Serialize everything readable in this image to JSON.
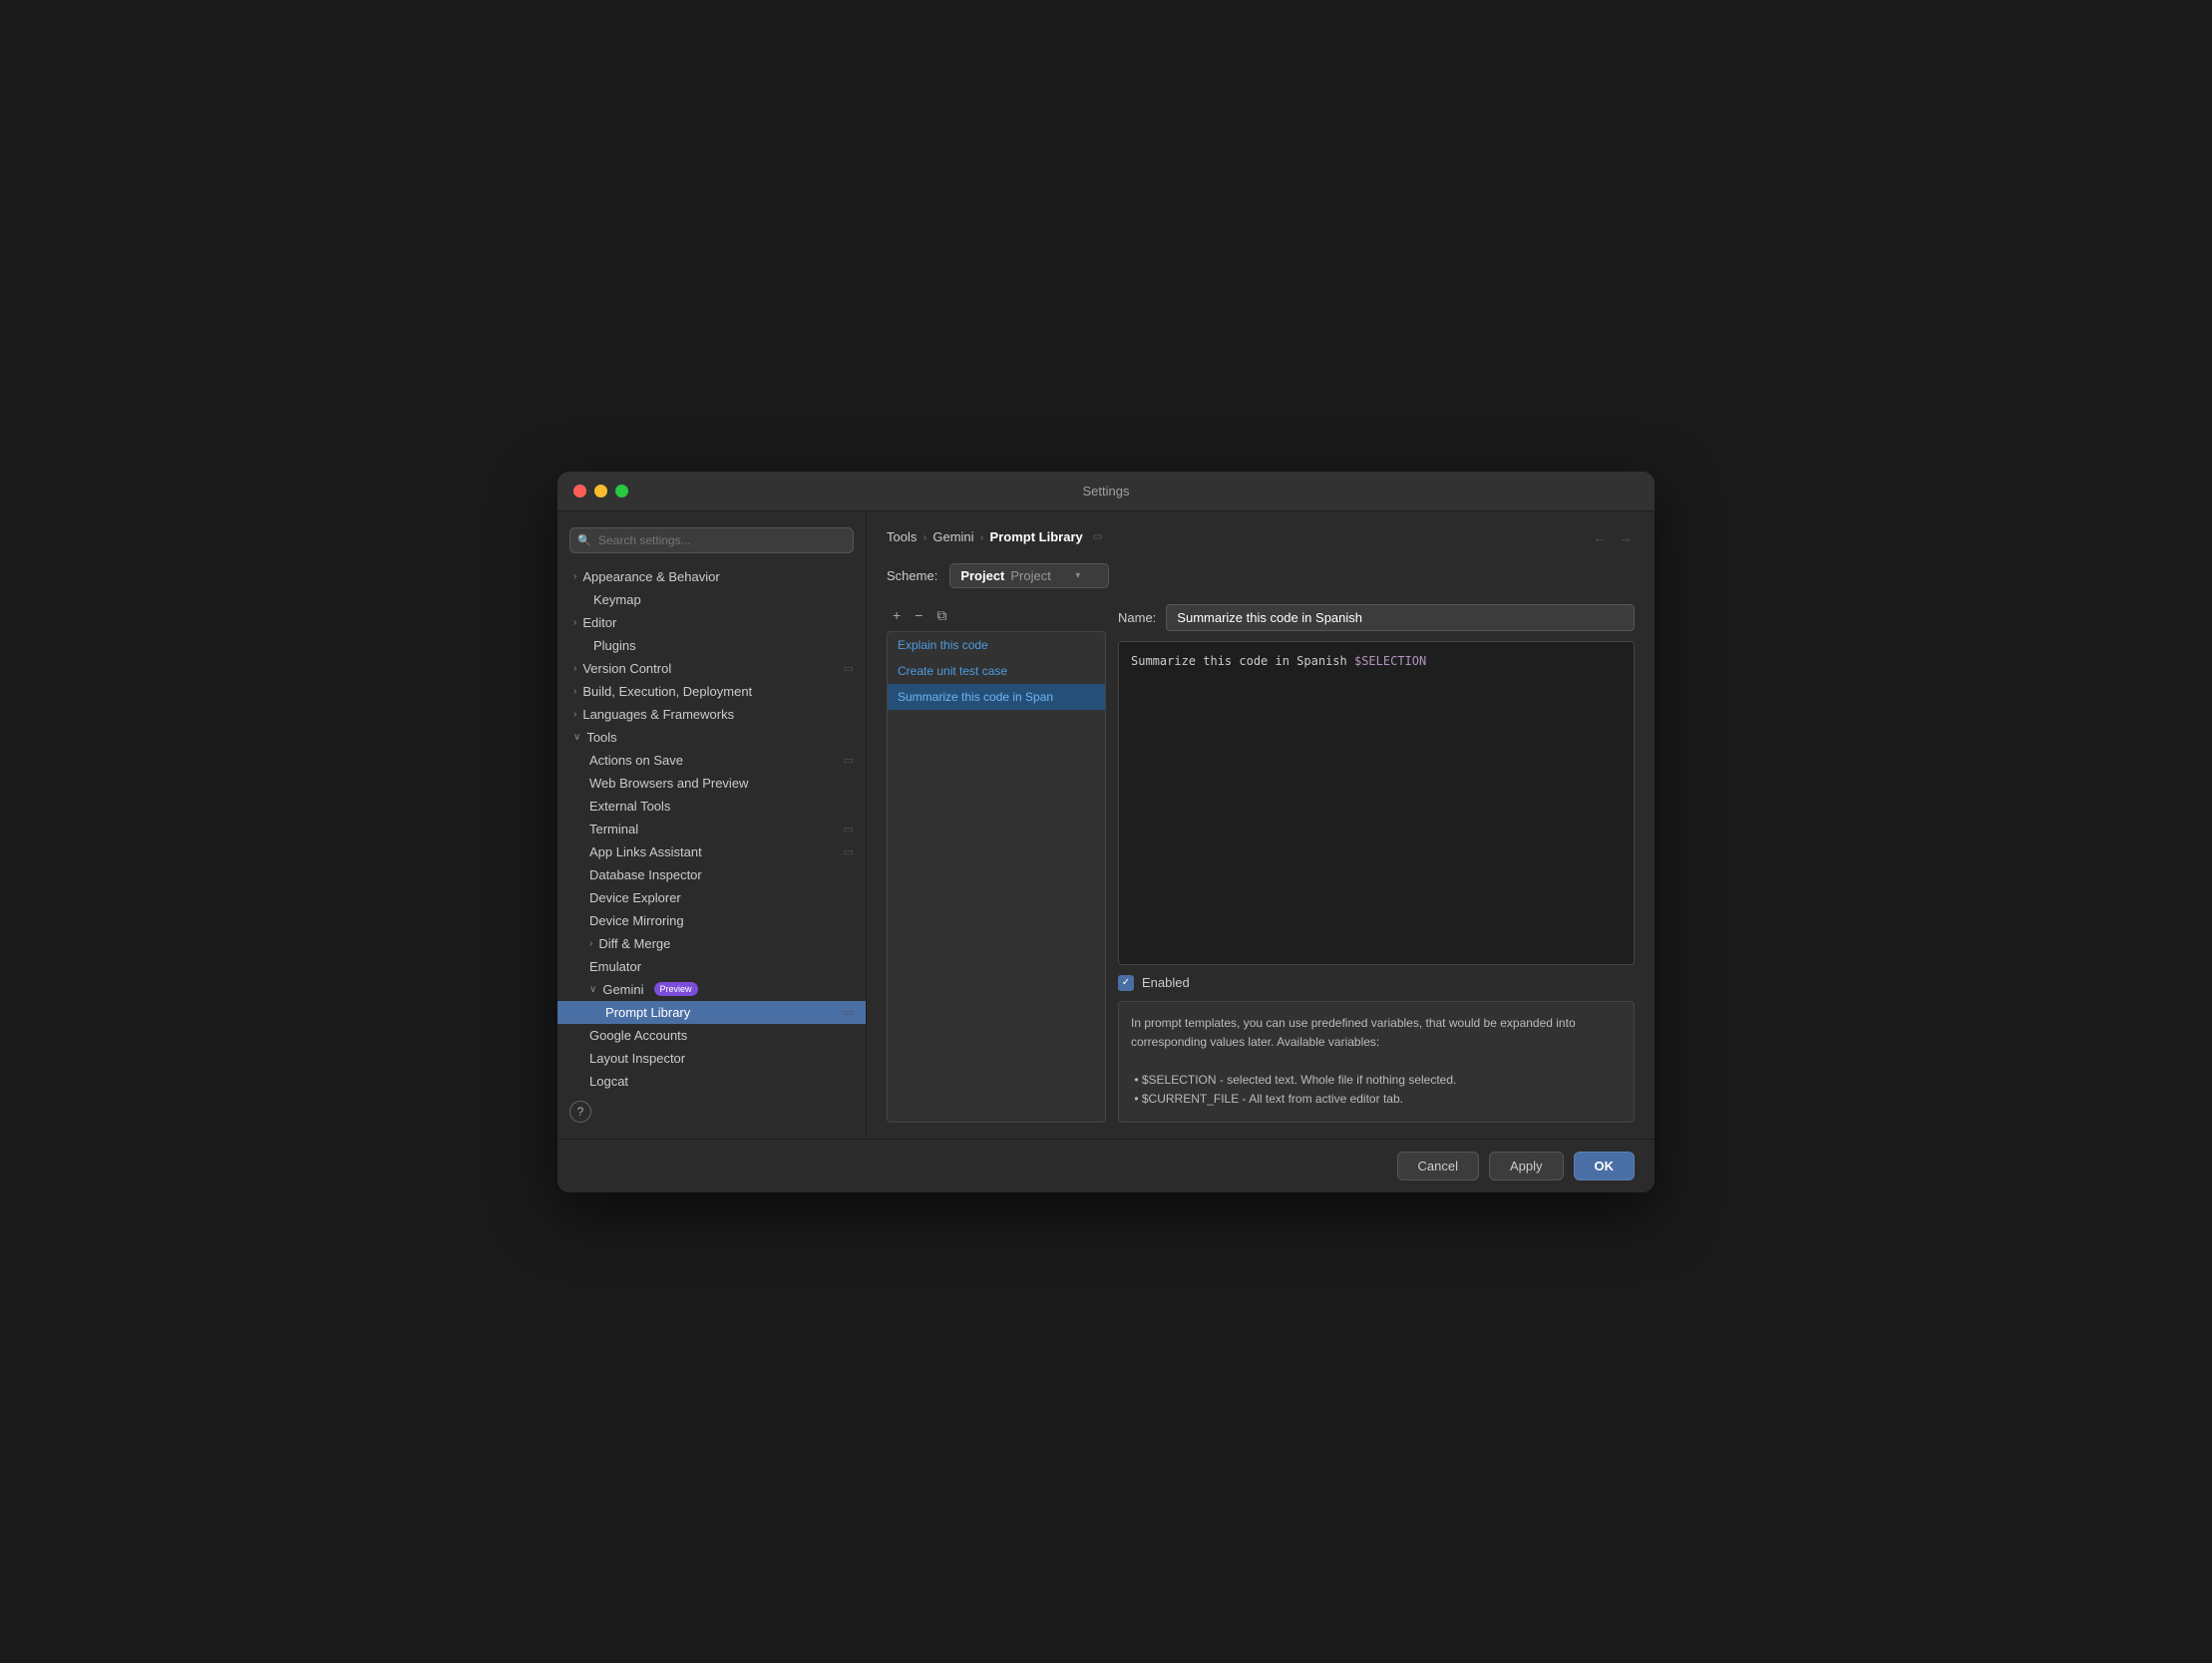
{
  "window": {
    "title": "Settings"
  },
  "sidebar": {
    "search_placeholder": "🔍",
    "items": [
      {
        "id": "appearance",
        "label": "Appearance & Behavior",
        "level": 0,
        "expandable": true,
        "expanded": false
      },
      {
        "id": "keymap",
        "label": "Keymap",
        "level": 0,
        "expandable": false
      },
      {
        "id": "editor",
        "label": "Editor",
        "level": 0,
        "expandable": true,
        "expanded": false
      },
      {
        "id": "plugins",
        "label": "Plugins",
        "level": 0,
        "expandable": false
      },
      {
        "id": "version-control",
        "label": "Version Control",
        "level": 0,
        "expandable": true,
        "expanded": false,
        "has_icon": true
      },
      {
        "id": "build",
        "label": "Build, Execution, Deployment",
        "level": 0,
        "expandable": true,
        "expanded": false
      },
      {
        "id": "languages",
        "label": "Languages & Frameworks",
        "level": 0,
        "expandable": true,
        "expanded": false
      },
      {
        "id": "tools",
        "label": "Tools",
        "level": 0,
        "expandable": true,
        "expanded": true
      },
      {
        "id": "actions-on-save",
        "label": "Actions on Save",
        "level": 1,
        "expandable": false,
        "has_icon": true
      },
      {
        "id": "web-browsers",
        "label": "Web Browsers and Preview",
        "level": 1,
        "expandable": false
      },
      {
        "id": "external-tools",
        "label": "External Tools",
        "level": 1,
        "expandable": false
      },
      {
        "id": "terminal",
        "label": "Terminal",
        "level": 1,
        "expandable": false,
        "has_icon": true
      },
      {
        "id": "app-links",
        "label": "App Links Assistant",
        "level": 1,
        "expandable": false,
        "has_icon": true
      },
      {
        "id": "database-inspector",
        "label": "Database Inspector",
        "level": 1,
        "expandable": false
      },
      {
        "id": "device-explorer",
        "label": "Device Explorer",
        "level": 1,
        "expandable": false
      },
      {
        "id": "device-mirroring",
        "label": "Device Mirroring",
        "level": 1,
        "expandable": false
      },
      {
        "id": "diff-merge",
        "label": "Diff & Merge",
        "level": 1,
        "expandable": true,
        "expanded": false
      },
      {
        "id": "emulator",
        "label": "Emulator",
        "level": 1,
        "expandable": false
      },
      {
        "id": "gemini",
        "label": "Gemini",
        "level": 1,
        "expandable": true,
        "expanded": true,
        "badge": "Preview"
      },
      {
        "id": "prompt-library",
        "label": "Prompt Library",
        "level": 2,
        "expandable": false,
        "selected": true,
        "has_icon": true
      },
      {
        "id": "google-accounts",
        "label": "Google Accounts",
        "level": 1,
        "expandable": false
      },
      {
        "id": "layout-inspector",
        "label": "Layout Inspector",
        "level": 1,
        "expandable": false
      },
      {
        "id": "logcat",
        "label": "Logcat",
        "level": 1,
        "expandable": false
      }
    ]
  },
  "breadcrumb": {
    "items": [
      "Tools",
      "Gemini",
      "Prompt Library"
    ],
    "separators": [
      "›",
      "›"
    ]
  },
  "scheme": {
    "label": "Scheme:",
    "value_bold": "Project",
    "value_light": "Project"
  },
  "toolbar": {
    "add_label": "+",
    "remove_label": "−",
    "copy_label": "⧉"
  },
  "prompt_list": {
    "items": [
      {
        "id": "explain",
        "label": "Explain this code"
      },
      {
        "id": "unit-test",
        "label": "Create unit test case"
      },
      {
        "id": "summarize",
        "label": "Summarize this code in Span",
        "selected": true
      }
    ]
  },
  "detail": {
    "name_label": "Name:",
    "name_value": "Summarize this code in Spanish",
    "prompt_text_prefix": "Summarize this code in Spanish ",
    "prompt_var": "$SELECTION",
    "enabled_label": "Enabled",
    "enabled": true,
    "info_text": "In prompt templates, you can use predefined variables, that would be expanded into corresponding values later. Available variables:\n\n • $SELECTION - selected text. Whole file if nothing selected.\n • $CURRENT_FILE - All text from active editor tab."
  },
  "footer": {
    "cancel_label": "Cancel",
    "apply_label": "Apply",
    "ok_label": "OK"
  }
}
